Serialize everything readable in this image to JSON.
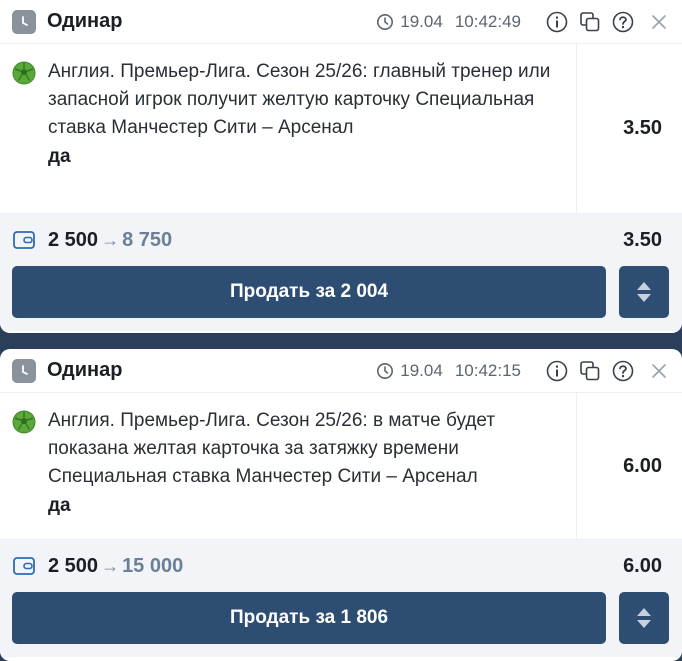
{
  "colors": {
    "background": "#2b3f5a",
    "button": "#2d4e72",
    "payout_text": "#6b7f99",
    "sport_icon": "#5aa83a"
  },
  "bets": [
    {
      "type_label": "Одинар",
      "date": "19.04",
      "time": "10:42:49",
      "event": "Англия. Премьер-Лига. Сезон 25/26: главный тренер или запасной игрок получит желтую карточку Специальная ставка Манчестер Сити – Арсенал",
      "outcome": "да",
      "odds": "3.50",
      "stake": "2 500",
      "payout": "8 750",
      "summary_odds": "3.50",
      "sell_label": "Продать за 2 004",
      "icons": {
        "type": "clock-icon",
        "sport": "football-icon",
        "wallet": "wallet-icon",
        "info": "info-icon",
        "copy": "copy-icon",
        "help": "help-icon",
        "close": "close-icon",
        "expand": "expand-sort-icon"
      }
    },
    {
      "type_label": "Одинар",
      "date": "19.04",
      "time": "10:42:15",
      "event": "Англия. Премьер-Лига. Сезон 25/26: в матче будет показана желтая карточка за затяжку времени Специальная ставка Манчестер Сити – Арсенал",
      "outcome": "да",
      "odds": "6.00",
      "stake": "2 500",
      "payout": "15 000",
      "summary_odds": "6.00",
      "sell_label": "Продать за 1 806",
      "icons": {
        "type": "clock-icon",
        "sport": "football-icon",
        "wallet": "wallet-icon",
        "info": "info-icon",
        "copy": "copy-icon",
        "help": "help-icon",
        "close": "close-icon",
        "expand": "expand-sort-icon"
      }
    }
  ]
}
